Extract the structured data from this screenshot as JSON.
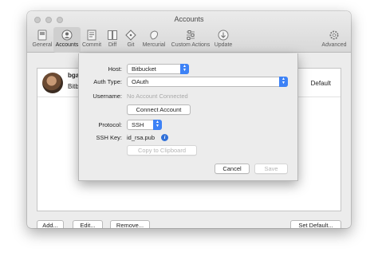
{
  "window": {
    "title": "Accounts"
  },
  "toolbar": {
    "items": [
      {
        "label": "General",
        "icon": "general-icon"
      },
      {
        "label": "Accounts",
        "icon": "accounts-icon"
      },
      {
        "label": "Commit",
        "icon": "commit-icon"
      },
      {
        "label": "Diff",
        "icon": "diff-icon"
      },
      {
        "label": "Git",
        "icon": "git-icon"
      },
      {
        "label": "Mercurial",
        "icon": "mercurial-icon"
      },
      {
        "label": "Custom Actions",
        "icon": "custom-actions-icon"
      },
      {
        "label": "Update",
        "icon": "update-icon"
      },
      {
        "label": "Advanced",
        "icon": "gear-icon"
      }
    ],
    "active": "Accounts"
  },
  "accounts": {
    "row": {
      "name": "bgar",
      "sub": "Bitbu",
      "default_label": "Default"
    }
  },
  "footer": {
    "add": "Add...",
    "edit": "Edit...",
    "remove": "Remove...",
    "set_default": "Set Default..."
  },
  "sheet": {
    "host_label": "Host:",
    "host_value": "Bitbucket",
    "auth_label": "Auth Type:",
    "auth_value": "OAuth",
    "username_label": "Username:",
    "username_placeholder": "No Account Connected",
    "connect_button": "Connect Account",
    "protocol_label": "Protocol:",
    "protocol_value": "SSH",
    "sshkey_label": "SSH Key:",
    "sshkey_value": "id_rsa.pub",
    "copy_button": "Copy to Clipboard",
    "cancel_button": "Cancel",
    "save_button": "Save"
  },
  "colors": {
    "accent": "#3d82f6",
    "info": "#2f6fd8"
  }
}
